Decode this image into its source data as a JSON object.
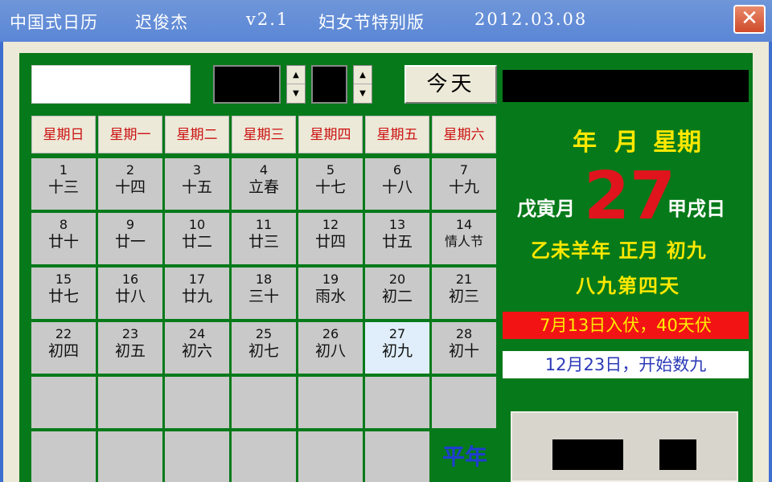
{
  "window": {
    "title_segments": [
      "中国式日历",
      "迟俊杰",
      "v2.1",
      "妇女节特别版",
      "2012.03.08"
    ],
    "close_label": "✕"
  },
  "controls": {
    "today_label": "今天",
    "spin_up": "▲",
    "spin_down": "▼"
  },
  "weekdays": [
    "星期日",
    "星期一",
    "星期二",
    "星期三",
    "星期四",
    "星期五",
    "星期六"
  ],
  "calendar": {
    "today_index": 26,
    "rows": [
      [
        [
          "1",
          "十三"
        ],
        [
          "2",
          "十四"
        ],
        [
          "3",
          "十五"
        ],
        [
          "4",
          "立春"
        ],
        [
          "5",
          "十七"
        ],
        [
          "6",
          "十八"
        ],
        [
          "7",
          "十九"
        ]
      ],
      [
        [
          "8",
          "廿十"
        ],
        [
          "9",
          "廿一"
        ],
        [
          "10",
          "廿二"
        ],
        [
          "11",
          "廿三"
        ],
        [
          "12",
          "廿四"
        ],
        [
          "13",
          "廿五"
        ],
        [
          "14",
          "情人节"
        ]
      ],
      [
        [
          "15",
          "廿七"
        ],
        [
          "16",
          "廿八"
        ],
        [
          "17",
          "廿九"
        ],
        [
          "18",
          "三十"
        ],
        [
          "19",
          "雨水"
        ],
        [
          "20",
          "初二"
        ],
        [
          "21",
          "初三"
        ]
      ],
      [
        [
          "22",
          "初四"
        ],
        [
          "23",
          "初五"
        ],
        [
          "24",
          "初六"
        ],
        [
          "25",
          "初七"
        ],
        [
          "26",
          "初八"
        ],
        [
          "27",
          "初九"
        ],
        [
          "28",
          "初十"
        ]
      ]
    ],
    "year_type": "平年"
  },
  "info": {
    "year_label": "年",
    "month_label": "月",
    "week_label": "星期",
    "big_day": "27",
    "month_ganzhi": "戊寅月",
    "day_ganzhi": "甲戌日",
    "lunar_line": "乙未羊年 正月 初九",
    "jiu_line": "八九第四天",
    "fu_text": "7月13日入伏，40天伏",
    "shujiu_text": "12月23日，开始数九"
  },
  "colors": {
    "panel_green": "#067a1a",
    "title_blue": "#5a86d6",
    "highlight_red": "#e0141c",
    "lunar_yellow": "#ffe800"
  }
}
